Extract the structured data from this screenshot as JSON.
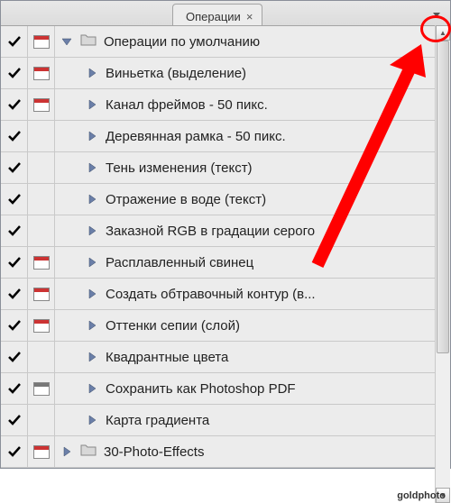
{
  "tab": {
    "title": "Операции",
    "close": "×"
  },
  "rows": [
    {
      "check": true,
      "dialog": "red",
      "indent": 0,
      "toggle": "down",
      "folder": true,
      "label": "Операции по умолчанию"
    },
    {
      "check": true,
      "dialog": "red",
      "indent": 1,
      "toggle": "right",
      "folder": false,
      "label": "Виньетка (выделение)"
    },
    {
      "check": true,
      "dialog": "red",
      "indent": 1,
      "toggle": "right",
      "folder": false,
      "label": "Канал фреймов - 50 пикс."
    },
    {
      "check": true,
      "dialog": "none",
      "indent": 1,
      "toggle": "right",
      "folder": false,
      "label": "Деревянная рамка - 50 пикс."
    },
    {
      "check": true,
      "dialog": "none",
      "indent": 1,
      "toggle": "right",
      "folder": false,
      "label": "Тень изменения (текст)"
    },
    {
      "check": true,
      "dialog": "none",
      "indent": 1,
      "toggle": "right",
      "folder": false,
      "label": "Отражение в воде (текст)"
    },
    {
      "check": true,
      "dialog": "none",
      "indent": 1,
      "toggle": "right",
      "folder": false,
      "label": "Заказной RGB в градации серого"
    },
    {
      "check": true,
      "dialog": "red",
      "indent": 1,
      "toggle": "right",
      "folder": false,
      "label": "Расплавленный свинец"
    },
    {
      "check": true,
      "dialog": "red",
      "indent": 1,
      "toggle": "right",
      "folder": false,
      "label": "Создать обтравочный контур (в..."
    },
    {
      "check": true,
      "dialog": "red",
      "indent": 1,
      "toggle": "right",
      "folder": false,
      "label": "Оттенки сепии (слой)"
    },
    {
      "check": true,
      "dialog": "none",
      "indent": 1,
      "toggle": "right",
      "folder": false,
      "label": "Квадрантные цвета"
    },
    {
      "check": true,
      "dialog": "grey",
      "indent": 1,
      "toggle": "right",
      "folder": false,
      "label": "Сохранить как Photoshop PDF"
    },
    {
      "check": true,
      "dialog": "none",
      "indent": 1,
      "toggle": "right",
      "folder": false,
      "label": "Карта градиента"
    },
    {
      "check": true,
      "dialog": "red",
      "indent": 0,
      "toggle": "right",
      "folder": true,
      "label": "30-Photo-Effects"
    }
  ],
  "watermark": "goldphoto"
}
